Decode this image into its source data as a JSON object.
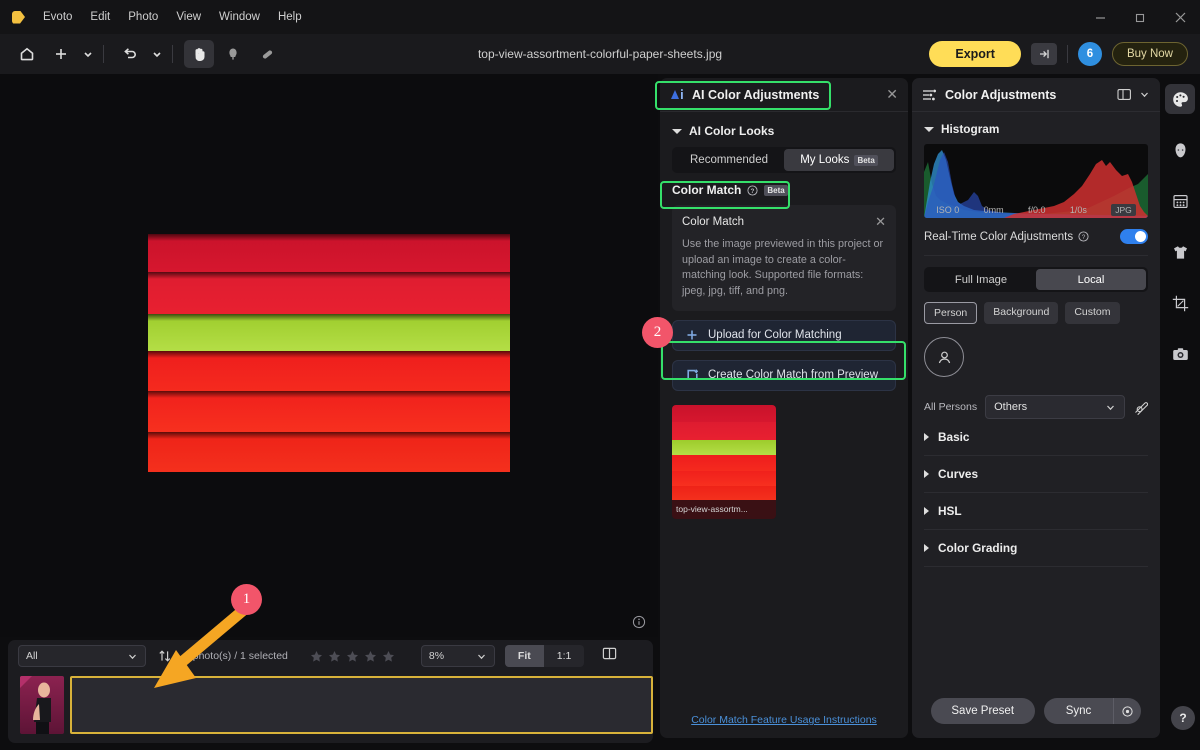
{
  "window": {
    "app_name": "Evoto",
    "menus": [
      "Evoto",
      "Edit",
      "Photo",
      "View",
      "Window",
      "Help"
    ],
    "controls": {
      "minimize": "minimize-icon",
      "maximize": "restore-icon",
      "close": "close-icon"
    }
  },
  "toolbar": {
    "title": "top-view-assortment-colorful-paper-sheets.jpg",
    "tools": [
      {
        "name": "home-icon"
      },
      {
        "name": "add-icon"
      },
      {
        "name": "chevron-down-icon"
      },
      {
        "name": "undo-icon"
      },
      {
        "name": "chevron-down-icon"
      },
      {
        "name": "hand-tool-icon"
      },
      {
        "name": "stamp-tool-icon"
      },
      {
        "name": "healing-brush-icon"
      }
    ],
    "export_label": "Export",
    "share_icon": "export-arrow-icon",
    "credits": "6",
    "buy_label": "Buy Now"
  },
  "left_rail": [
    {
      "name": "image-adjust-icon"
    },
    {
      "name": "mask-circle-icon"
    },
    {
      "name": "history-icon"
    }
  ],
  "canvas": {
    "info_icon": "info-icon",
    "strips": [
      {
        "color": "#c8142b",
        "height": 24
      },
      {
        "color": "#e01f32",
        "height": 27
      },
      {
        "color": "#a8d132",
        "height": 31
      },
      {
        "color": "#f02020",
        "height": 38
      },
      {
        "color": "#f2241e",
        "height": 42
      },
      {
        "color": "#ee2218",
        "height": 40
      }
    ]
  },
  "mid_panel": {
    "title": "AI Color Adjustments",
    "title_icon": "ai-icon",
    "close_icon": "close-icon",
    "section": "AI Color Looks",
    "tabs": [
      {
        "label": "Recommended",
        "selected": false,
        "badge": ""
      },
      {
        "label": "My Looks",
        "selected": true,
        "badge": "Beta"
      }
    ],
    "color_match": {
      "label": "Color Match",
      "help_icon": "help-circle-icon",
      "badge": "Beta"
    },
    "tip": {
      "title": "Color Match",
      "close_icon": "close-icon",
      "body": "Use the image previewed in this project or upload an image to create a color-matching look. Supported file formats: jpeg, jpg, tiff, and png."
    },
    "buttons": [
      {
        "label": "Upload for Color Matching",
        "icon": "plus-icon"
      },
      {
        "label": "Create Color Match from Preview",
        "icon": "create-from-preview-icon"
      }
    ],
    "swatch": {
      "name": "top-view-assortm..."
    },
    "link": "Color Match Feature Usage Instructions"
  },
  "right_panel": {
    "title": "Color Adjustments",
    "title_icon": "sliders-icon",
    "layout_icon": "panel-layout-icon",
    "chevron_icon": "chevron-down-icon",
    "histogram_label": "Histogram",
    "histogram_meta": {
      "iso": "ISO 0",
      "focal": "0mm",
      "aperture": "f/0.0",
      "shutter": "1/0s",
      "format": "JPG"
    },
    "realtime": {
      "label": "Real-Time Color Adjustments",
      "help_icon": "help-circle-icon",
      "enabled": true
    },
    "scope_tabs": [
      {
        "label": "Full Image",
        "selected": false
      },
      {
        "label": "Local",
        "selected": true
      }
    ],
    "chips": [
      {
        "label": "Person",
        "selected": true
      },
      {
        "label": "Background",
        "selected": false
      },
      {
        "label": "Custom",
        "selected": false
      }
    ],
    "avatar_icon": "person-icon",
    "persons": {
      "label": "All Persons",
      "value": "Others",
      "edit_icon": "edit-mask-icon"
    },
    "sections": [
      "Basic",
      "Curves",
      "HSL",
      "Color Grading"
    ],
    "footer": {
      "save_preset": "Save Preset",
      "sync": "Sync",
      "sync_settings_icon": "settings-icon"
    },
    "help_label": "?"
  },
  "right_rail": [
    {
      "name": "palette-icon",
      "active": true
    },
    {
      "name": "face-icon",
      "active": false
    },
    {
      "name": "retouch-grid-icon",
      "active": false
    },
    {
      "name": "clothing-icon",
      "active": false
    },
    {
      "name": "crop-icon",
      "active": false
    },
    {
      "name": "camera-icon",
      "active": false
    }
  ],
  "bottom_bar": {
    "filter": "All",
    "sort_icon": "sort-icon",
    "count": "2 photo(s) / 1 selected",
    "stars": 5,
    "zoom": "8%",
    "fit_label": "Fit",
    "one_to_one_label": "1:1",
    "compare_icon": "compare-view-icon",
    "thumbnails": [
      {
        "name": "portrait-thumbnail",
        "selected": false
      },
      {
        "name": "paper-sheets-thumbnail",
        "selected": true
      }
    ]
  },
  "annotations": {
    "steps": [
      {
        "number": "1",
        "target": "paper-sheets-thumbnail"
      },
      {
        "number": "2",
        "target": "create-color-match-from-preview"
      }
    ],
    "highlight_color": "#35e06a",
    "arrow_color": "#f5a623",
    "badge_color": "#f2556a"
  }
}
